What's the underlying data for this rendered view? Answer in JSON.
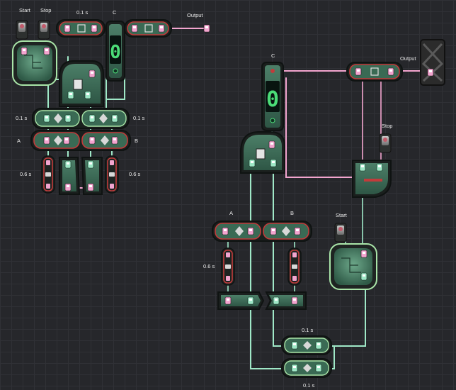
{
  "colors": {
    "background": "#26272b",
    "grid": "#303136",
    "panel_outer": "#1f2422",
    "panel_green": "#3b6a55",
    "panel_rim": "#8ad2a0",
    "delay_rim": "#c23b3b",
    "wire_green": "#9fe8c7",
    "wire_pink": "#f3a5cf",
    "display_digit": "#4bdc77"
  },
  "left_circuit": {
    "labels": {
      "start": "Start",
      "stop": "Stop",
      "delay_top": "0.1 s",
      "counter": "C",
      "output": "Output",
      "delay_left": "0.1 s",
      "delay_right": "0.1 s",
      "gate_a": "A",
      "gate_b": "B",
      "delay_long_left": "0.6 s",
      "delay_long_right": "0.6 s"
    },
    "display_value": "0"
  },
  "right_circuit": {
    "labels": {
      "counter": "C",
      "output": "Output",
      "stop": "Stop",
      "gate_a": "A",
      "gate_b": "B",
      "start": "Start",
      "delay_long_left": "0.6 s",
      "delay_mid": "0.1 s",
      "delay_bottom": "0.1 s"
    },
    "display_value": "0"
  },
  "icons": [
    "button-icon",
    "delay-icon",
    "gate-icon",
    "display-icon",
    "port-icon",
    "lamp-icon",
    "logic-board-icon"
  ]
}
